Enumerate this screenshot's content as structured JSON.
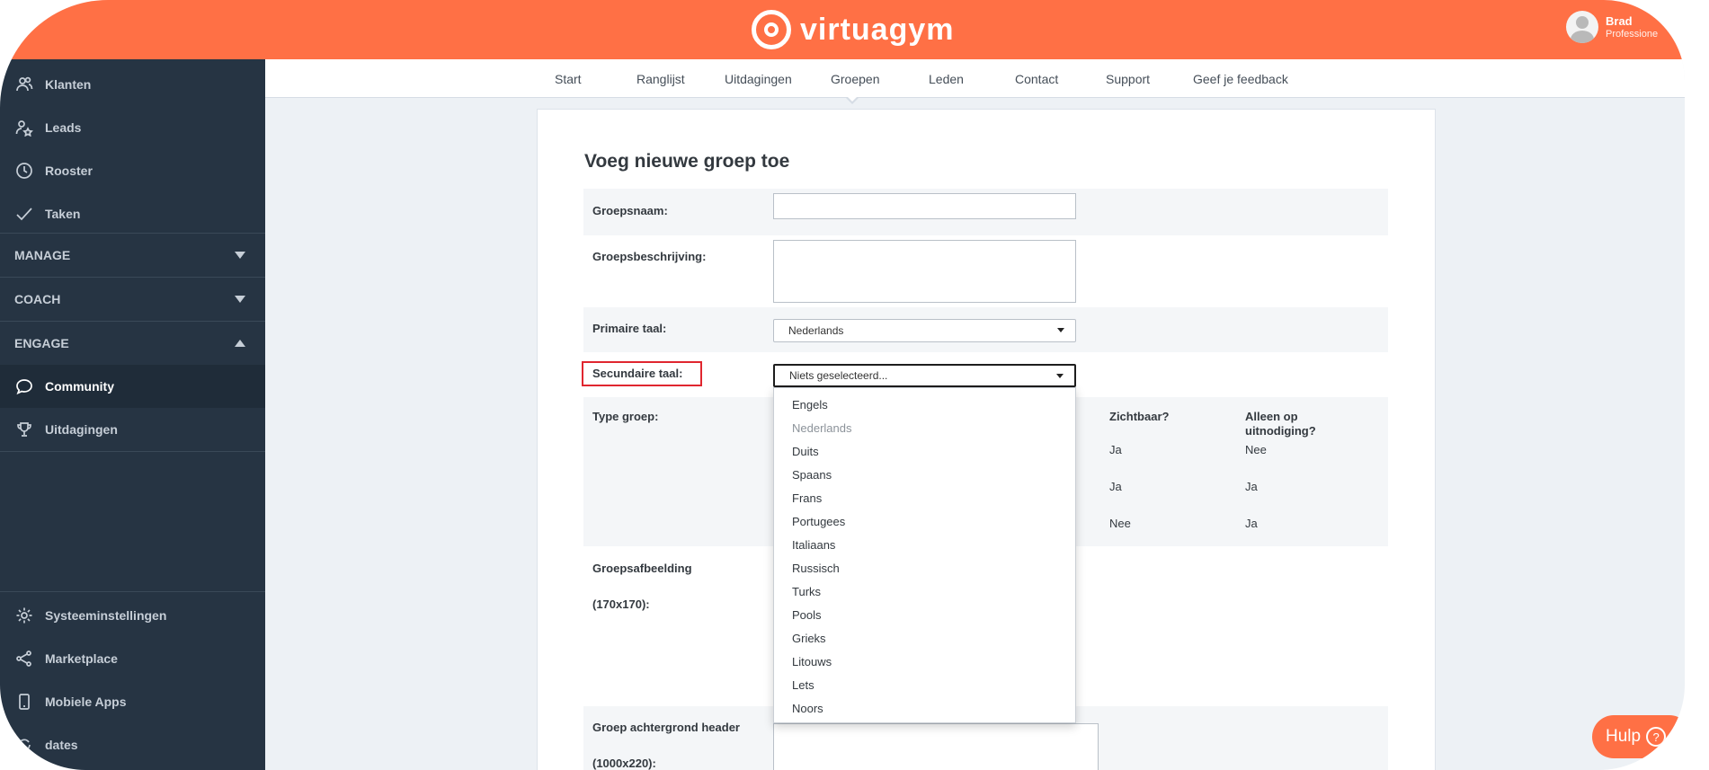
{
  "app": {
    "brand": "virtuagym"
  },
  "user": {
    "name": "Brad",
    "role": "Professione"
  },
  "sidebar": {
    "top_items": [
      {
        "label": "Klanten",
        "icon": "users-icon"
      },
      {
        "label": "Leads",
        "icon": "lead-star-icon"
      },
      {
        "label": "Rooster",
        "icon": "clock-icon"
      },
      {
        "label": "Taken",
        "icon": "check-icon"
      }
    ],
    "sections": [
      {
        "label": "MANAGE",
        "expanded": false
      },
      {
        "label": "COACH",
        "expanded": false
      },
      {
        "label": "ENGAGE",
        "expanded": true
      }
    ],
    "engage_items": [
      {
        "label": "Community",
        "icon": "chat-bubble-icon",
        "active": true
      },
      {
        "label": "Uitdagingen",
        "icon": "trophy-icon",
        "active": false
      }
    ],
    "bottom_items": [
      {
        "label": "Systeeminstellingen",
        "icon": "gear-icon"
      },
      {
        "label": "Marketplace",
        "icon": "share-icon"
      },
      {
        "label": "Mobiele Apps",
        "icon": "phone-icon"
      },
      {
        "label": "dates",
        "icon": "updates-icon"
      }
    ]
  },
  "tabs": [
    "Start",
    "Ranglijst",
    "Uitdagingen",
    "Groepen",
    "Leden",
    "Contact",
    "Support",
    "Geef je feedback"
  ],
  "active_tab": "Groepen",
  "form": {
    "title": "Voeg nieuwe groep toe",
    "groepsnaam_label": "Groepsnaam:",
    "groepsnaam_value": "",
    "beschrijving_label": "Groepsbeschrijving:",
    "beschrijving_value": "",
    "primaire_taal_label": "Primaire taal:",
    "primaire_taal_value": "Nederlands",
    "secundaire_taal_label": "Secundaire taal:",
    "secundaire_taal_value": "Niets geselecteerd...",
    "type_groep_label": "Type groep:",
    "type_columns": [
      "Zichtbaar?",
      "Alleen op uitnodiging?"
    ],
    "type_rows": [
      [
        "Ja",
        "Nee"
      ],
      [
        "Ja",
        "Ja"
      ],
      [
        "Nee",
        "Ja"
      ]
    ],
    "afbeelding_label": "Groepsafbeelding",
    "afbeelding_size": "(170x170):",
    "header_label": "Groep achtergrond header",
    "header_size": "(1000x220):"
  },
  "dropdown": {
    "options": [
      {
        "label": "Engels",
        "disabled": false
      },
      {
        "label": "Nederlands",
        "disabled": true
      },
      {
        "label": "Duits",
        "disabled": false
      },
      {
        "label": "Spaans",
        "disabled": false
      },
      {
        "label": "Frans",
        "disabled": false
      },
      {
        "label": "Portugees",
        "disabled": false
      },
      {
        "label": "Italiaans",
        "disabled": false
      },
      {
        "label": "Russisch",
        "disabled": false
      },
      {
        "label": "Turks",
        "disabled": false
      },
      {
        "label": "Pools",
        "disabled": false
      },
      {
        "label": "Grieks",
        "disabled": false
      },
      {
        "label": "Litouws",
        "disabled": false
      },
      {
        "label": "Lets",
        "disabled": false
      },
      {
        "label": "Noors",
        "disabled": false
      }
    ]
  },
  "help_button": {
    "label": "Hulp",
    "icon": "question-icon"
  },
  "colors": {
    "brand": "#ff7045",
    "sidebar": "#263443",
    "highlight": "#e0262f"
  }
}
